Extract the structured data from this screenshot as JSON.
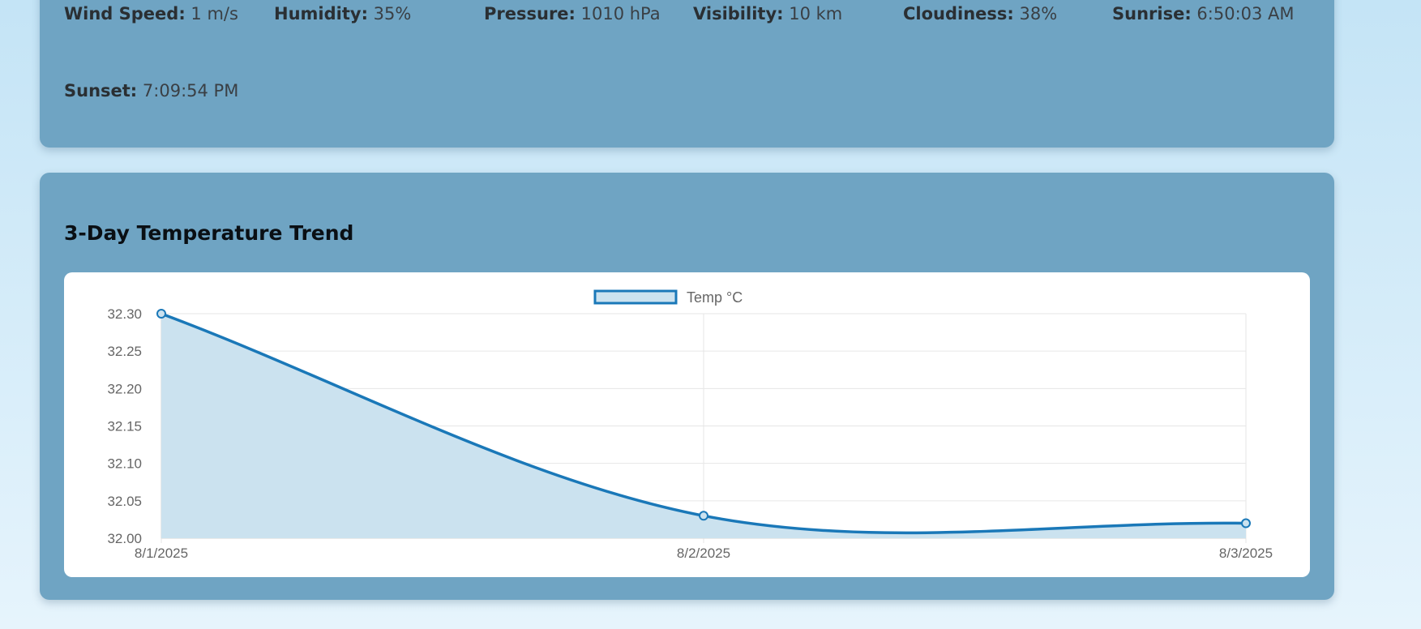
{
  "details": [
    {
      "label": "Wind Speed:",
      "value": "1 m/s"
    },
    {
      "label": "Humidity:",
      "value": "35%"
    },
    {
      "label": "Pressure:",
      "value": "1010 hPa"
    },
    {
      "label": "Visibility:",
      "value": "10 km"
    },
    {
      "label": "Cloudiness:",
      "value": "38%"
    },
    {
      "label": "Sunrise:",
      "value": "6:50:03 AM"
    },
    {
      "label": "Sunset:",
      "value": "7:09:54 PM"
    }
  ],
  "chart_section": {
    "title": "3-Day Temperature Trend"
  },
  "chart_data": {
    "type": "line",
    "fill": true,
    "categories": [
      "8/1/2025",
      "8/2/2025",
      "8/3/2025"
    ],
    "series": [
      {
        "name": "Temp °C",
        "values": [
          32.3,
          32.03,
          32.02
        ],
        "color": "#1a78b8",
        "fill_color": "#cbe2ef"
      }
    ],
    "ylim": [
      32.0,
      32.3
    ],
    "yticks": [
      "32.30",
      "32.25",
      "32.20",
      "32.15",
      "32.10",
      "32.05",
      "32.00"
    ],
    "legend_position": "top",
    "grid": true
  }
}
